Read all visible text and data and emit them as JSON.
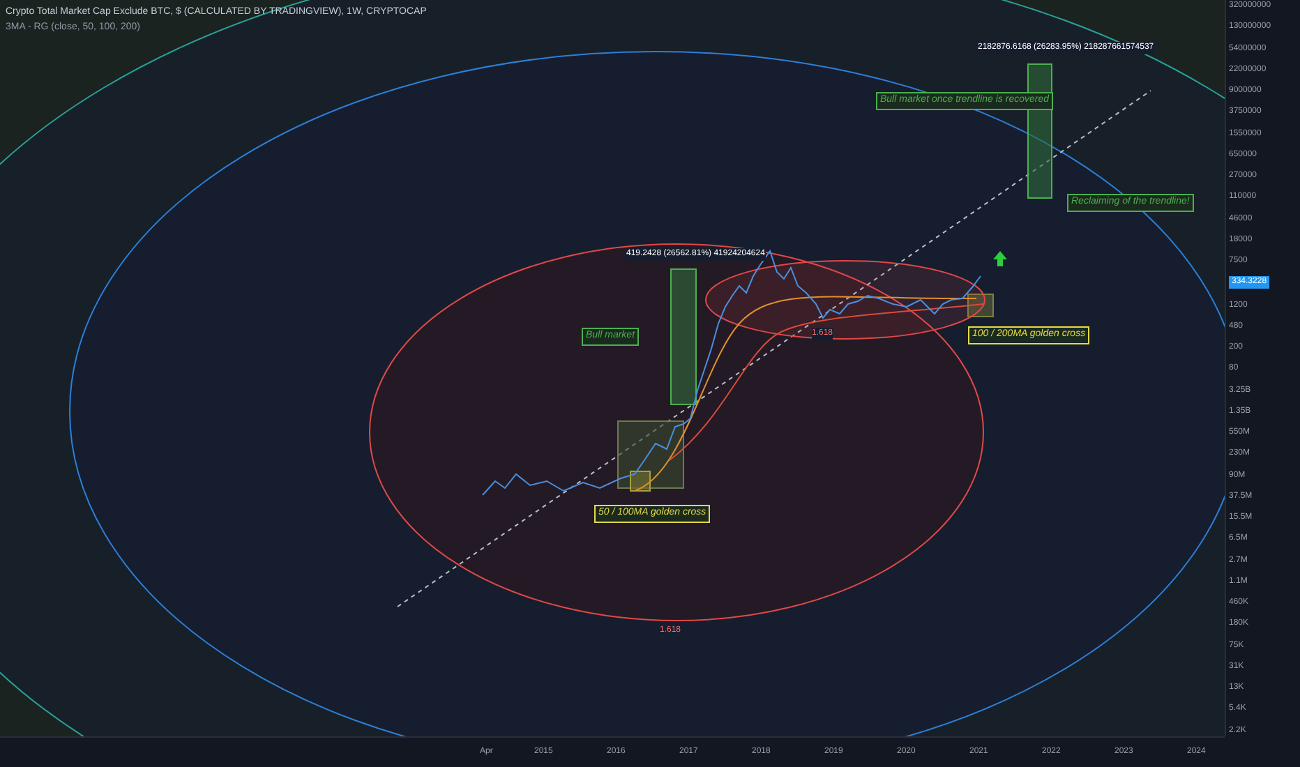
{
  "header": {
    "title": "Crypto Total Market Cap Exclude BTC, $ (CALCULATED BY TRADINGVIEW), 1W, CRYPTOCAP",
    "indicator": "3MA - RG (close, 50, 100, 200)"
  },
  "price_axis": [
    {
      "kind": "tick",
      "label": "320000000"
    },
    {
      "kind": "tick",
      "label": "130000000"
    },
    {
      "kind": "tick",
      "label": "54000000"
    },
    {
      "kind": "tick",
      "label": "22000000"
    },
    {
      "kind": "tick",
      "label": "9000000"
    },
    {
      "kind": "tick",
      "label": "3750000"
    },
    {
      "kind": "tick",
      "label": "1550000"
    },
    {
      "kind": "tick",
      "label": "650000"
    },
    {
      "kind": "tick",
      "label": "270000"
    },
    {
      "kind": "tick",
      "label": "110000"
    },
    {
      "kind": "tick",
      "label": "46000"
    },
    {
      "kind": "tick",
      "label": "18000"
    },
    {
      "kind": "tick",
      "label": "7500"
    },
    {
      "kind": "price",
      "label": "334.3228"
    },
    {
      "kind": "tick",
      "label": "1200"
    },
    {
      "kind": "tick",
      "label": "480"
    },
    {
      "kind": "tick",
      "label": "200"
    },
    {
      "kind": "tick",
      "label": "80"
    },
    {
      "kind": "tick",
      "label": "3.25B"
    },
    {
      "kind": "tick",
      "label": "1.35B"
    },
    {
      "kind": "tick",
      "label": "550M"
    },
    {
      "kind": "tick",
      "label": "230M"
    },
    {
      "kind": "tick",
      "label": "90M"
    },
    {
      "kind": "tick",
      "label": "37.5M"
    },
    {
      "kind": "tick",
      "label": "15.5M"
    },
    {
      "kind": "tick",
      "label": "6.5M"
    },
    {
      "kind": "tick",
      "label": "2.7M"
    },
    {
      "kind": "tick",
      "label": "1.1M"
    },
    {
      "kind": "tick",
      "label": "460K"
    },
    {
      "kind": "tick",
      "label": "180K"
    },
    {
      "kind": "tick",
      "label": "75K"
    },
    {
      "kind": "tick",
      "label": "31K"
    },
    {
      "kind": "tick",
      "label": "13K"
    },
    {
      "kind": "tick",
      "label": "5.4K"
    },
    {
      "kind": "tick",
      "label": "2.2K"
    }
  ],
  "time_axis": [
    "Apr",
    "2015",
    "2016",
    "2017",
    "2018",
    "2019",
    "2020",
    "2021",
    "2022",
    "2023",
    "2024"
  ],
  "measurements": [
    "419.2428 (26562.81%) 41924204624",
    "2182876.6168 (26283.95%) 218287661574537"
  ],
  "notes": [
    {
      "text": "Bull market",
      "color": "#4caf50"
    },
    {
      "text": "Bull market once trendline is recovered",
      "color": "#4caf50"
    },
    {
      "text": "Reclaiming of the trendline!",
      "color": "#4caf50"
    },
    {
      "text": "50 / 100MA golden cross",
      "color": "#e6d84a"
    },
    {
      "text": "100 / 200MA golden cross",
      "color": "#e6d84a"
    }
  ],
  "fib_labels": [
    "1.618",
    "1.618"
  ]
}
